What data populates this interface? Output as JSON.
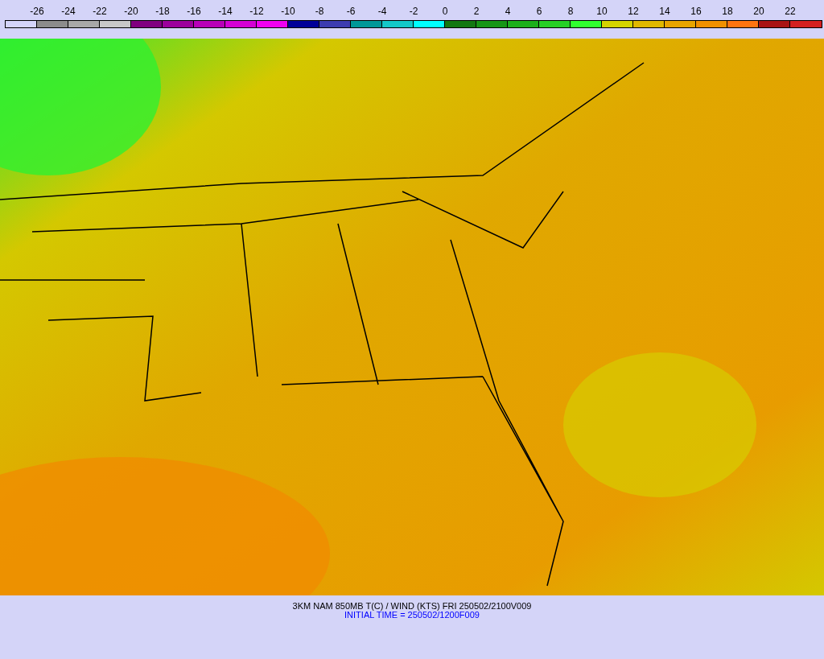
{
  "legend": {
    "labels": [
      "-26",
      "-24",
      "-22",
      "-20",
      "-18",
      "-16",
      "-14",
      "-12",
      "-10",
      "-8",
      "-6",
      "-4",
      "-2",
      "0",
      "2",
      "4",
      "6",
      "8",
      "10",
      "12",
      "14",
      "16",
      "18",
      "20",
      "22"
    ],
    "bins": [
      {
        "color": "#d4d4fa"
      },
      {
        "color": "#8c8c8c"
      },
      {
        "color": "#a8a8a8"
      },
      {
        "color": "#c8c8c8"
      },
      {
        "color": "#800080"
      },
      {
        "color": "#9c009c"
      },
      {
        "color": "#b800b8"
      },
      {
        "color": "#d400d4"
      },
      {
        "color": "#f000f0"
      },
      {
        "color": "#000098"
      },
      {
        "color": "#3c3cb0"
      },
      {
        "color": "#009898"
      },
      {
        "color": "#14c8c8"
      },
      {
        "color": "#00ffff"
      },
      {
        "color": "#127812"
      },
      {
        "color": "#169616"
      },
      {
        "color": "#1cb01c"
      },
      {
        "color": "#26d026"
      },
      {
        "color": "#30ff30"
      },
      {
        "color": "#d4d400"
      },
      {
        "color": "#e0b800"
      },
      {
        "color": "#e8a400"
      },
      {
        "color": "#f09000"
      },
      {
        "color": "#ff7410"
      },
      {
        "color": "#a81414"
      },
      {
        "color": "#d42020"
      }
    ]
  },
  "caption": {
    "title": "3KM NAM 850MB T(C) / WIND (KTS) FRI 250502/2100V009",
    "initial_time": "INITIAL TIME = 250502/1200F009"
  }
}
